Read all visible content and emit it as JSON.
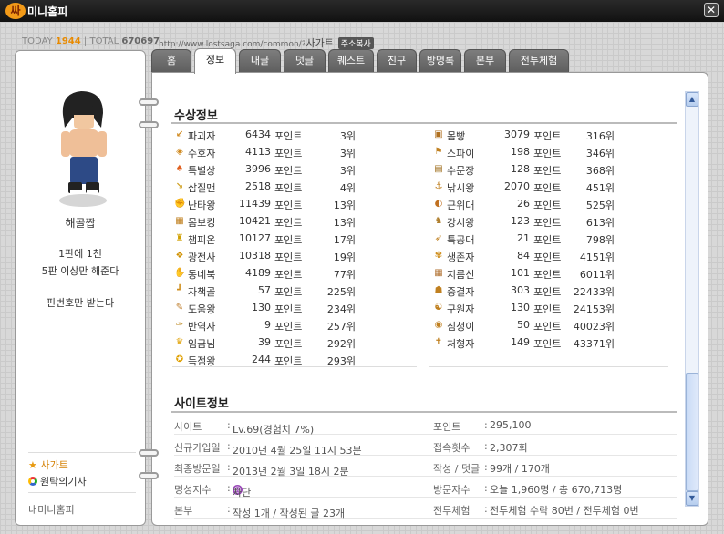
{
  "window": {
    "logo": "싸",
    "title": "미니홈피",
    "close_icon": "✕"
  },
  "stats": {
    "today_label": "TODAY",
    "today": "1944",
    "sep": "|",
    "total_label": "TOTAL",
    "total": "670697"
  },
  "url": {
    "text": "http://www.lostsaga.com/common/?",
    "nick": "사가트",
    "copy_label": "주소복사"
  },
  "profile": {
    "name": "해골짭",
    "intro1": "1판에 1천",
    "intro2": "5판 이상만 해준다",
    "intro3": "핀번호만 받는다"
  },
  "links": {
    "star_icon": "★",
    "sagatre": "사가트",
    "wontak": "원탁의기사",
    "mini": "내미니홈피"
  },
  "tabs": [
    "홈",
    "정보",
    "내글",
    "덧글",
    "퀘스트",
    "친구",
    "방명록",
    "본부",
    "전투체험"
  ],
  "awards_title": "수상정보",
  "awards_left": [
    {
      "name": "파괴자",
      "points": "6434",
      "unit": "포인트",
      "rank": "3위",
      "icon": "↙",
      "color": "#d08a20"
    },
    {
      "name": "수호자",
      "points": "4113",
      "unit": "포인트",
      "rank": "3위",
      "icon": "◈",
      "color": "#d08a20"
    },
    {
      "name": "특별상",
      "points": "3996",
      "unit": "포인트",
      "rank": "3위",
      "icon": "♠",
      "color": "#e06020"
    },
    {
      "name": "삽질맨",
      "points": "2518",
      "unit": "포인트",
      "rank": "4위",
      "icon": "↘",
      "color": "#d0a020"
    },
    {
      "name": "난타왕",
      "points": "11439",
      "unit": "포인트",
      "rank": "13위",
      "icon": "✊",
      "color": "#e08020"
    },
    {
      "name": "몸보킹",
      "points": "10421",
      "unit": "포인트",
      "rank": "13위",
      "icon": "▦",
      "color": "#c08020"
    },
    {
      "name": "챔피온",
      "points": "10127",
      "unit": "포인트",
      "rank": "17위",
      "icon": "♜",
      "color": "#d0a000"
    },
    {
      "name": "광전사",
      "points": "10318",
      "unit": "포인트",
      "rank": "19위",
      "icon": "❖",
      "color": "#d09000"
    },
    {
      "name": "동네북",
      "points": "4189",
      "unit": "포인트",
      "rank": "77위",
      "icon": "✋",
      "color": "#d08020"
    },
    {
      "name": "자책골",
      "points": "57",
      "unit": "포인트",
      "rank": "225위",
      "icon": "┛",
      "color": "#d09020"
    },
    {
      "name": "도움왕",
      "points": "130",
      "unit": "포인트",
      "rank": "234위",
      "icon": "✎",
      "color": "#c08030"
    },
    {
      "name": "반역자",
      "points": "9",
      "unit": "포인트",
      "rank": "257위",
      "icon": "✑",
      "color": "#c09030"
    },
    {
      "name": "임금님",
      "points": "39",
      "unit": "포인트",
      "rank": "292위",
      "icon": "♛",
      "color": "#e0a000"
    },
    {
      "name": "득점왕",
      "points": "244",
      "unit": "포인트",
      "rank": "293위",
      "icon": "✪",
      "color": "#e0a000"
    }
  ],
  "awards_right": [
    {
      "name": "몸빵",
      "points": "3079",
      "unit": "포인트",
      "rank": "316위",
      "icon": "▣",
      "color": "#b07020"
    },
    {
      "name": "스파이",
      "points": "198",
      "unit": "포인트",
      "rank": "346위",
      "icon": "⚑",
      "color": "#c08020"
    },
    {
      "name": "수문장",
      "points": "128",
      "unit": "포인트",
      "rank": "368위",
      "icon": "▤",
      "color": "#a07020"
    },
    {
      "name": "낚시왕",
      "points": "2070",
      "unit": "포인트",
      "rank": "451위",
      "icon": "⚓",
      "color": "#c08020"
    },
    {
      "name": "근위대",
      "points": "26",
      "unit": "포인트",
      "rank": "525위",
      "icon": "◐",
      "color": "#c07020"
    },
    {
      "name": "강시왕",
      "points": "123",
      "unit": "포인트",
      "rank": "613위",
      "icon": "♞",
      "color": "#b08030"
    },
    {
      "name": "특공대",
      "points": "21",
      "unit": "포인트",
      "rank": "798위",
      "icon": "➶",
      "color": "#c08020"
    },
    {
      "name": "생존자",
      "points": "84",
      "unit": "포인트",
      "rank": "4151위",
      "icon": "✾",
      "color": "#d09020"
    },
    {
      "name": "지름신",
      "points": "101",
      "unit": "포인트",
      "rank": "6011위",
      "icon": "▦",
      "color": "#b07030"
    },
    {
      "name": "중결자",
      "points": "303",
      "unit": "포인트",
      "rank": "22433위",
      "icon": "☗",
      "color": "#c08020"
    },
    {
      "name": "구원자",
      "points": "130",
      "unit": "포인트",
      "rank": "24153위",
      "icon": "☯",
      "color": "#c08020"
    },
    {
      "name": "심청이",
      "points": "50",
      "unit": "포인트",
      "rank": "40023위",
      "icon": "◉",
      "color": "#c08020"
    },
    {
      "name": "처형자",
      "points": "149",
      "unit": "포인트",
      "rank": "43371위",
      "icon": "✝",
      "color": "#c08020"
    }
  ],
  "site_title": "사이트정보",
  "site_left": [
    {
      "label": "사이트",
      "value": "Lv.69(경험치 7%)"
    },
    {
      "label": "신규가입일",
      "value": "2010년 4월 25일 11시 53분"
    },
    {
      "label": "최종방문일",
      "value": "2013년 2월 3일 18시 2분"
    },
    {
      "label": "명성지수",
      "value": "차단",
      "ban_icon": "☹"
    },
    {
      "label": "본부",
      "value": "작성 1개 / 작성된 글 23개"
    }
  ],
  "site_right": [
    {
      "label": "포인트",
      "value": "295,100"
    },
    {
      "label": "접속횟수",
      "value": "2,307회"
    },
    {
      "label": "작성 / 덧글",
      "value": "99개 / 170개"
    },
    {
      "label": "방문자수",
      "value": "오늘 1,960명 / 총 670,713명"
    },
    {
      "label": "전투체험",
      "value": "전투체험 수락 80번 / 전투체험 0번"
    }
  ],
  "colon": ":",
  "scroll": {
    "up_icon": "▲",
    "down_icon": "▼"
  }
}
